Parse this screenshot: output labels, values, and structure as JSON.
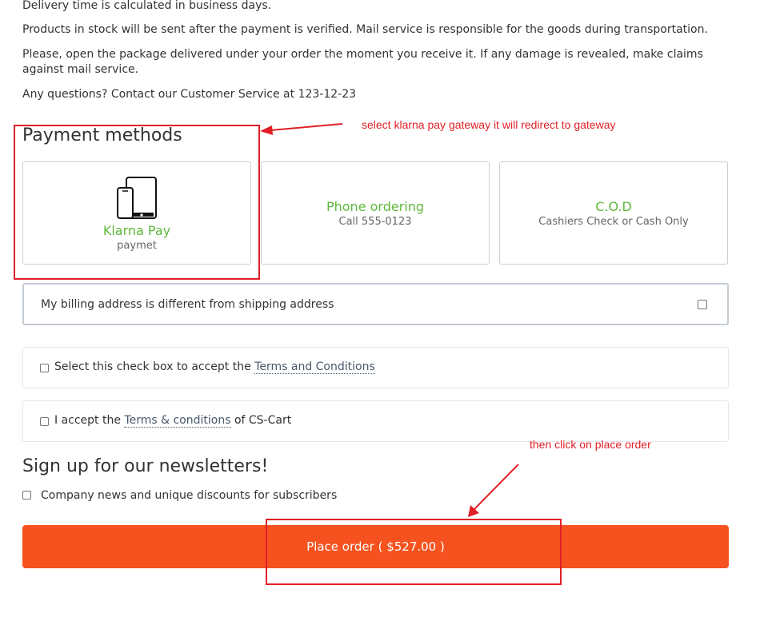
{
  "info": {
    "delivery": "Delivery time is calculated in business days.",
    "stock": "Products in stock will be sent after the payment is verified. Mail service is responsible for the goods during transportation.",
    "package": "Please, open the package delivered under your order the moment you receive it. If any damage is revealed, make claims against mail service.",
    "questions": "Any questions? Contact our Customer Service at 123-12-23"
  },
  "payment": {
    "title": "Payment methods",
    "methods": [
      {
        "name": "Klarna Pay",
        "description": "paymet",
        "icon": "mobile-tablet-icon"
      },
      {
        "name": "Phone ordering",
        "description": "Call 555-0123"
      },
      {
        "name": "C.O.D",
        "description": "Cashiers Check or Cash Only"
      }
    ]
  },
  "billing": {
    "label": "My billing address is different from shipping address",
    "checked": false
  },
  "terms": [
    {
      "prefix": "Select this check box to accept the ",
      "link": "Terms and Conditions",
      "suffix": "",
      "checked": false
    },
    {
      "prefix": "I accept the ",
      "link": "Terms & conditions",
      "suffix": " of CS-Cart",
      "checked": false
    }
  ],
  "newsletter": {
    "title": "Sign up for our newsletters!",
    "option": "Company news and unique discounts for subscribers",
    "checked": false
  },
  "place_order": {
    "label": "Place order ( $527.00 )"
  },
  "annotations": {
    "payment_note": "select klarna pay gateway it will redirect to gateway",
    "order_note": "then click on place order"
  },
  "colors": {
    "accent_green": "#5fb83c",
    "button_orange": "#f5521f",
    "annotation_red": "#e21f26"
  }
}
